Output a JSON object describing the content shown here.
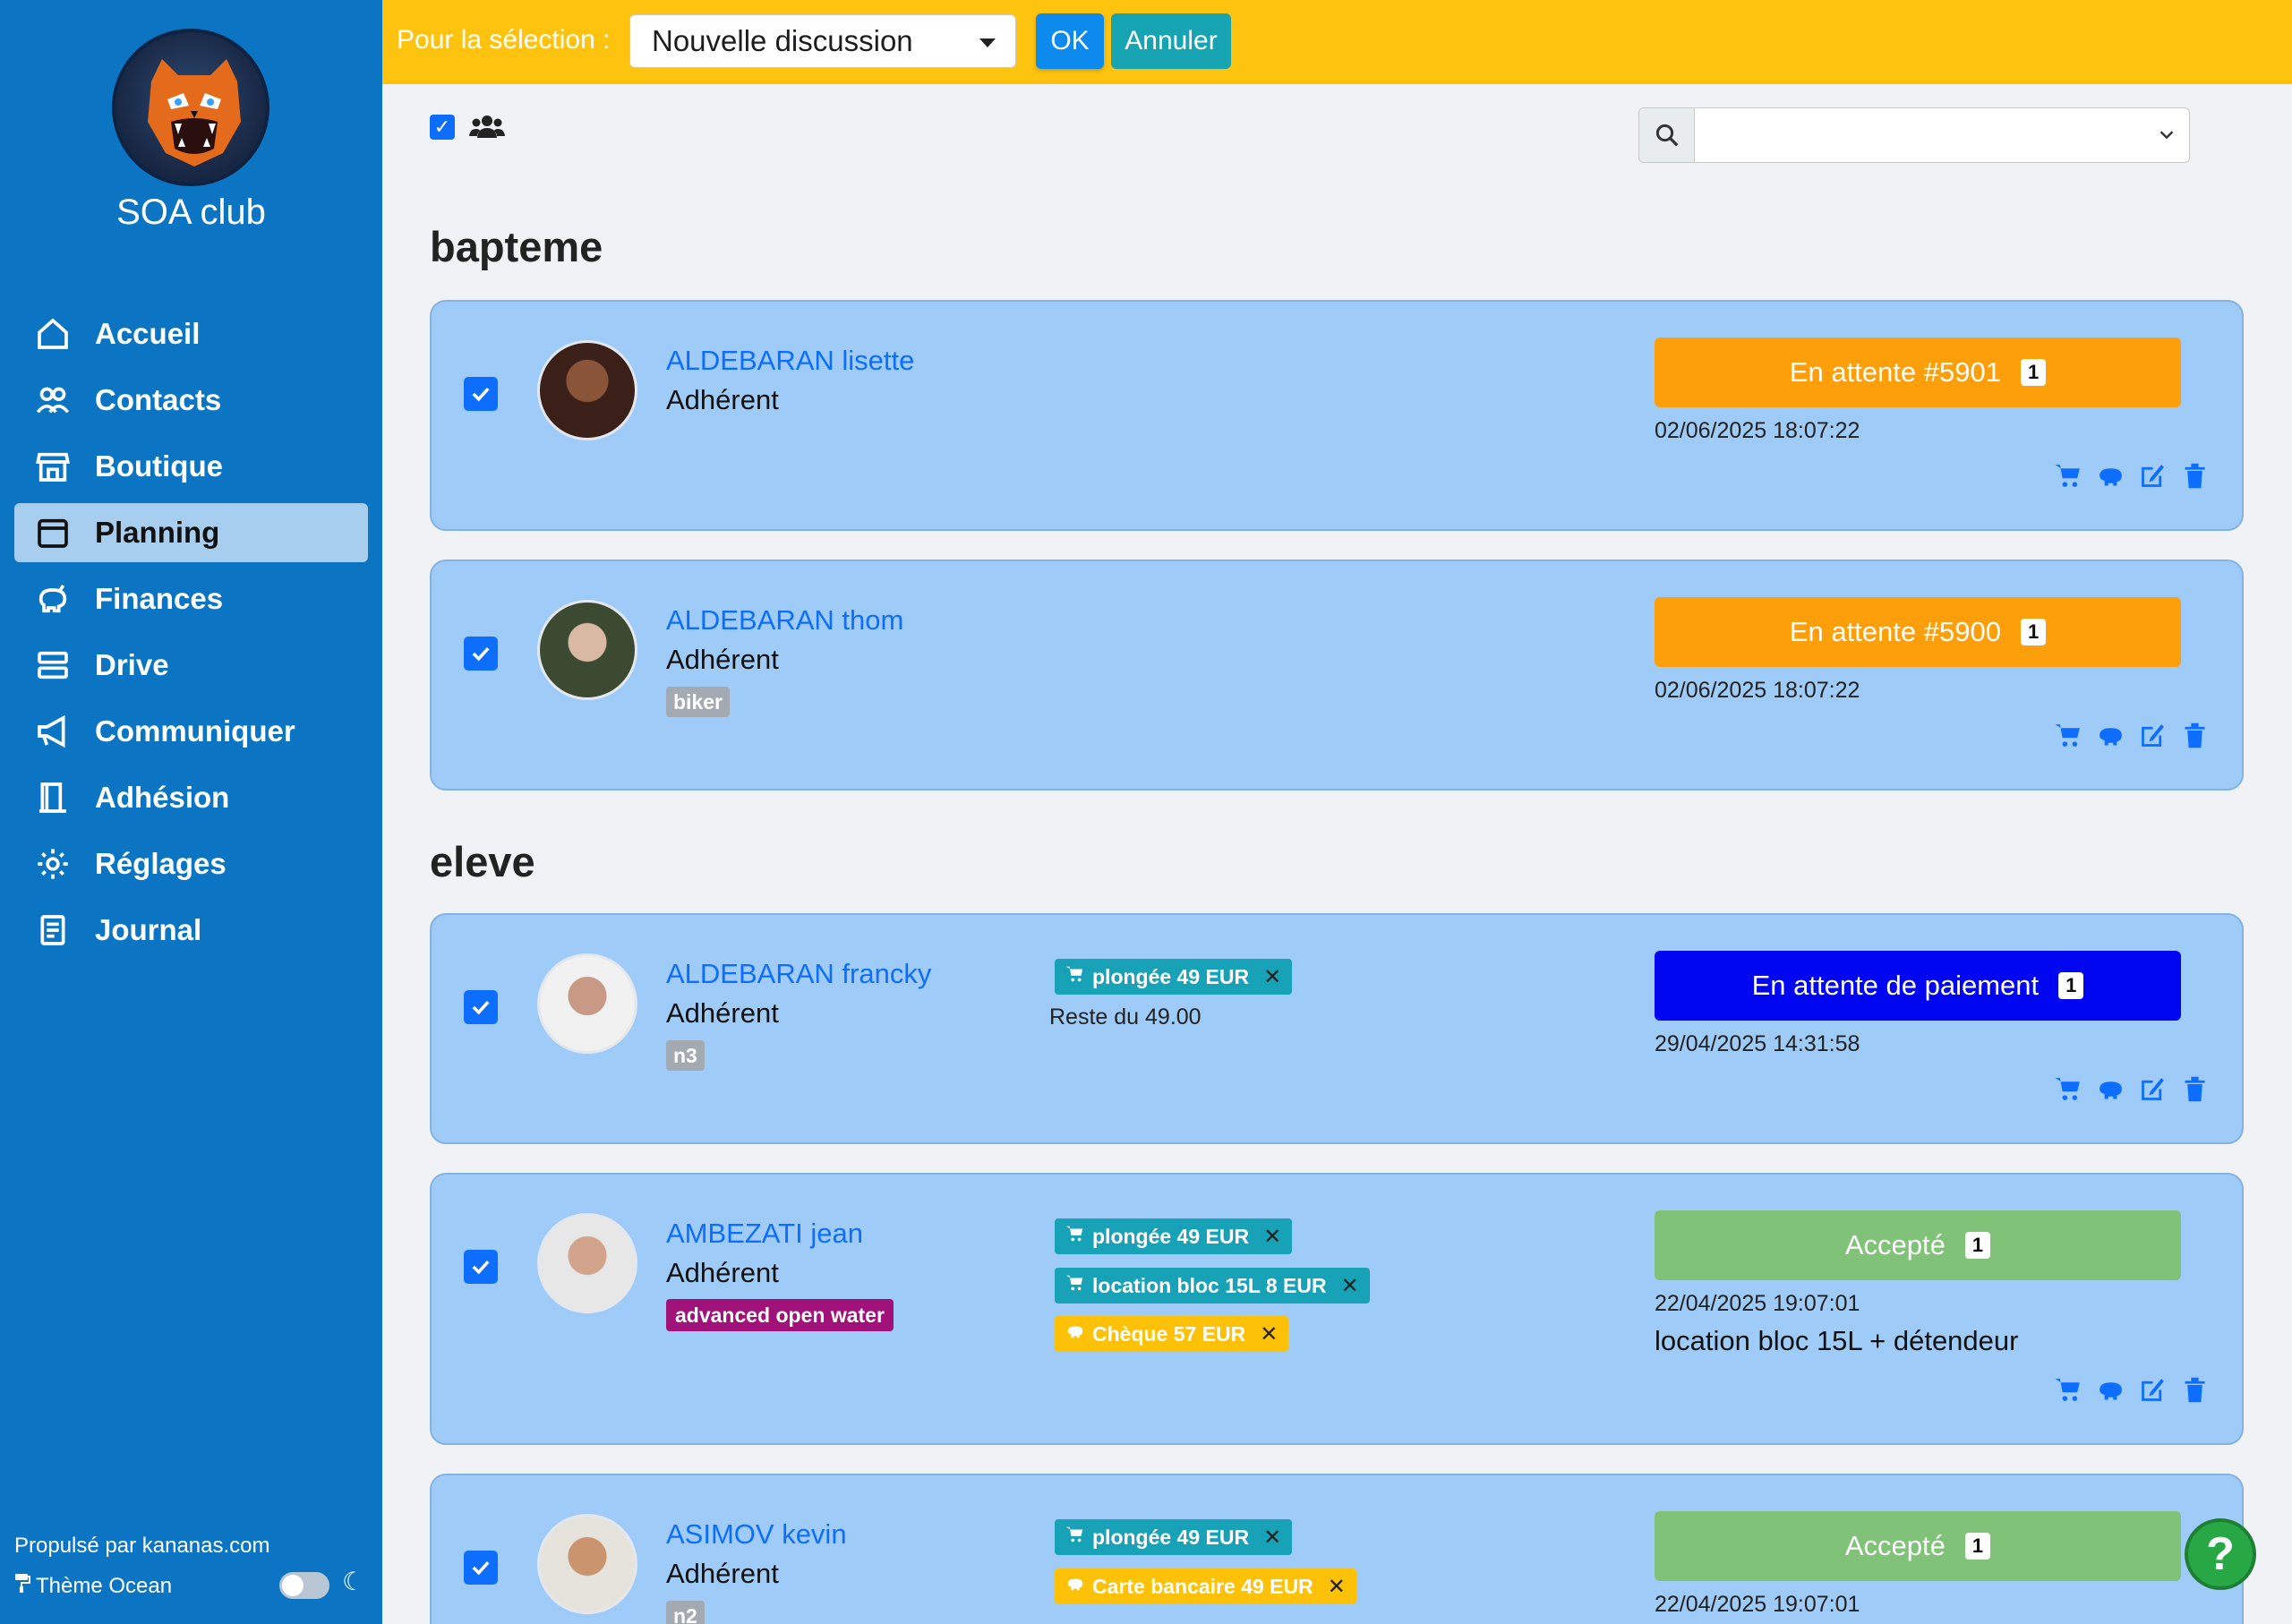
{
  "sidebar": {
    "club_name": "SOA club",
    "items": [
      {
        "label": "Accueil",
        "icon": "home-icon"
      },
      {
        "label": "Contacts",
        "icon": "contacts-icon"
      },
      {
        "label": "Boutique",
        "icon": "shop-icon"
      },
      {
        "label": "Planning",
        "icon": "calendar-icon",
        "active": true
      },
      {
        "label": "Finances",
        "icon": "piggy-bank-icon"
      },
      {
        "label": "Drive",
        "icon": "server-icon"
      },
      {
        "label": "Communiquer",
        "icon": "megaphone-icon"
      },
      {
        "label": "Adhésion",
        "icon": "door-icon"
      },
      {
        "label": "Réglages",
        "icon": "gear-icon"
      },
      {
        "label": "Journal",
        "icon": "journal-icon"
      }
    ],
    "powered_by": "Propulsé par kananas.com",
    "theme_label": "Thème Ocean",
    "moon": "☾"
  },
  "topbar": {
    "label": "Pour la sélection :",
    "selected": "Nouvelle discussion",
    "ok": "OK",
    "cancel": "Annuler"
  },
  "sections": {
    "bapteme": "bapteme",
    "eleve": "eleve"
  },
  "cards": [
    {
      "name": "ALDEBARAN lisette",
      "role": "Adhérent",
      "status": "En attente #5901",
      "count": "1",
      "date": "02/06/2025 18:07:22"
    },
    {
      "name": "ALDEBARAN thom",
      "role": "Adhérent",
      "tag": "biker",
      "status": "En attente #5900",
      "count": "1",
      "date": "02/06/2025 18:07:22"
    },
    {
      "name": "ALDEBARAN francky",
      "role": "Adhérent",
      "tag": "n3",
      "chips": [
        "plongée 49 EUR"
      ],
      "reste": "Reste du 49.00",
      "status": "En attente de paiement",
      "count": "1",
      "date": "29/04/2025 14:31:58"
    },
    {
      "name": "AMBEZATI jean",
      "role": "Adhérent",
      "tag": "advanced open water",
      "chips": [
        "plongée 49 EUR",
        "location bloc 15L 8 EUR",
        "Chèque 57 EUR"
      ],
      "status": "Accepté",
      "count": "1",
      "date": "22/04/2025 19:07:01",
      "note": "location bloc 15L + détendeur"
    },
    {
      "name": "ASIMOV kevin",
      "role": "Adhérent",
      "tag": "n2",
      "chips": [
        "plongée 49 EUR",
        "Carte bancaire 49 EUR"
      ],
      "status": "Accepté",
      "count": "1",
      "date": "22/04/2025 19:07:01"
    }
  ],
  "help": "?",
  "colors": {
    "sidebar": "#0b75c4",
    "topbar": "#fdc30e",
    "card": "#9ecbf8",
    "pending": "#fd9f0a",
    "payment": "#0007f0",
    "accepted": "#7fc278"
  }
}
